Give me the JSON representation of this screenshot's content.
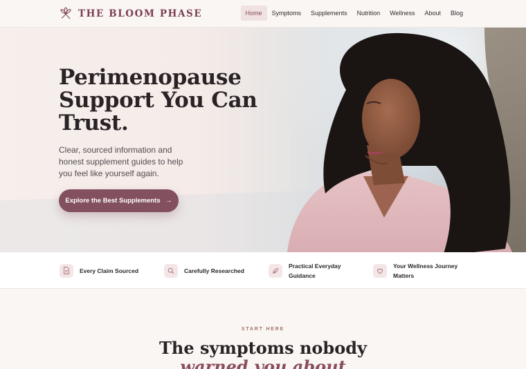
{
  "brand": {
    "name": "THE BLOOM PHASE",
    "icon": "flower-icon",
    "color": "#7a3e52"
  },
  "nav": {
    "items": [
      {
        "label": "Home",
        "active": true
      },
      {
        "label": "Symptoms",
        "active": false
      },
      {
        "label": "Supplements",
        "active": false
      },
      {
        "label": "Nutrition",
        "active": false
      },
      {
        "label": "Wellness",
        "active": false
      },
      {
        "label": "About",
        "active": false
      },
      {
        "label": "Blog",
        "active": false
      }
    ]
  },
  "hero": {
    "title": "Perimenopause Support You Can Trust.",
    "subtitle": "Clear, sourced information and honest supplement guides to help you feel like yourself again.",
    "cta_label": "Explore the Best Supplements",
    "cta_icon": "arrow-right-icon",
    "accent": "#82505f"
  },
  "trust": {
    "items": [
      {
        "label": "Every Claim Sourced",
        "icon": "document-icon"
      },
      {
        "label": "Carefully Researched",
        "icon": "search-icon"
      },
      {
        "label": "Practical Everyday Guidance",
        "icon": "leaf-icon"
      },
      {
        "label": "Your Wellness Journey Matters",
        "icon": "heart-icon"
      }
    ]
  },
  "section": {
    "eyebrow": "START HERE",
    "title_line1": "The symptoms nobody",
    "title_line2": "warned you about"
  }
}
